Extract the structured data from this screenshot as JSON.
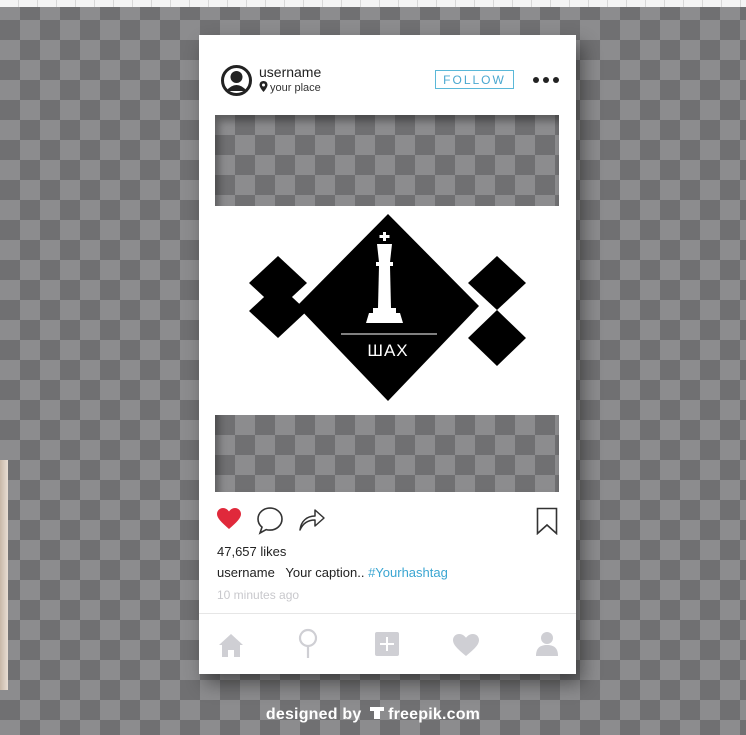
{
  "post": {
    "username": "username",
    "location": "your place",
    "follow_label": "FOLLOW",
    "image": {
      "logo_text": "ШАХ",
      "logo_description_icon": "king-chess-piece-icon"
    },
    "likes": "47,657 likes",
    "caption_user": "username",
    "caption_text": "Your caption..",
    "hashtag": "#Yourhashtag",
    "time": "10 minutes ago",
    "liked": true
  },
  "nav": {
    "items": [
      "home-icon",
      "search-icon",
      "add-icon",
      "heart-icon",
      "profile-icon"
    ]
  },
  "credit": {
    "prefix": "designed by",
    "brand": "freepik.com"
  },
  "colors": {
    "like_red": "#e0293b",
    "follow_blue": "#4aa8d0",
    "hashtag_blue": "#3ba6d2",
    "nav_gray": "#cfcfd4"
  }
}
